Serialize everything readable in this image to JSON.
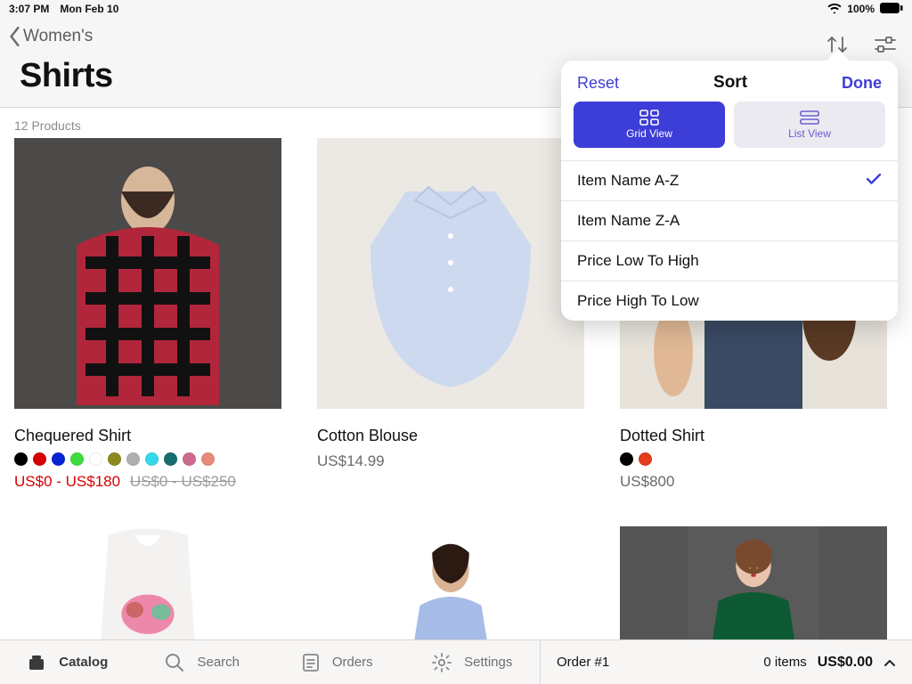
{
  "status": {
    "time": "3:07 PM",
    "date": "Mon Feb 10",
    "battery": "100%"
  },
  "nav": {
    "back": "Women's",
    "title": "Shirts"
  },
  "count_label": "12 Products",
  "products": [
    {
      "name": "Chequered Shirt",
      "swatches": [
        "#000000",
        "#d60000",
        "#0724d6",
        "#3edc3e",
        "#ffffff",
        "#8a8a1f",
        "#b0b0b0",
        "#33d9e8",
        "#166e6e",
        "#cf6a8f",
        "#e88a7a"
      ],
      "sale_price": "US$0 - US$180",
      "orig_price": "US$0 - US$250"
    },
    {
      "name": "Cotton Blouse",
      "price": "US$14.99"
    },
    {
      "name": "Dotted Shirt",
      "swatches": [
        "#000000",
        "#e63b1d"
      ],
      "price": "US$800"
    }
  ],
  "sort": {
    "reset": "Reset",
    "title": "Sort",
    "done": "Done",
    "grid_label": "Grid View",
    "list_label": "List View",
    "options": [
      "Item Name A-Z",
      "Item Name Z-A",
      "Price Low To High",
      "Price High To Low"
    ],
    "selected": 0
  },
  "tabs": {
    "catalog": "Catalog",
    "search": "Search",
    "orders": "Orders",
    "settings": "Settings"
  },
  "order": {
    "label": "Order #1",
    "items": "0 items",
    "total": "US$0.00"
  }
}
